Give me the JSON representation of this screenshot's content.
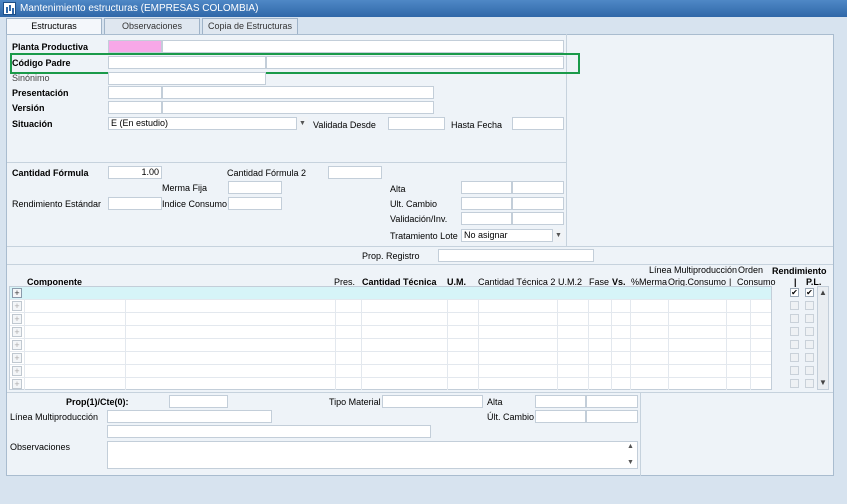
{
  "window": {
    "title": "Mantenimiento estructuras (EMPRESAS COLOMBIA)"
  },
  "tabs": [
    "Estructuras",
    "Observaciones",
    "Copia de Estructuras"
  ],
  "header": {
    "planta": "Planta Productiva",
    "codigo_padre": "Código Padre",
    "sinonimo": "Sinónimo",
    "presentacion": "Presentación",
    "version": "Versión",
    "situacion": "Situación",
    "situacion_value": "E (En estudio)",
    "validada_desde": "Validada Desde",
    "hasta_fecha": "Hasta Fecha"
  },
  "formula": {
    "cantidad_formula": "Cantidad Fórmula",
    "cantidad_formula_value": "1.00",
    "cantidad_formula_2": "Cantidad Fórmula 2",
    "merma_fija": "Merma Fija",
    "rendimiento_estandar": "Rendimiento  Estándar",
    "indice_consumo": "Indice Consumo",
    "alta": "Alta",
    "ult_cambio": "Ult. Cambio",
    "validacion": "Validación/Inv.",
    "tratamiento_lote": "Tratamiento Lote",
    "tratamiento_lote_value": "No asignar",
    "prop_registro": "Prop. Registro"
  },
  "grid": {
    "top_labels": {
      "linea": "Línea Multiproducción",
      "orden": "Orden",
      "rendimiento": "Rendimiento"
    },
    "cols": {
      "componente": "Componente",
      "pres": "Pres.",
      "cant_tecnica": "Cantidad Técnica",
      "um": "U.M.",
      "cant_tecnica_2": "Cantidad Técnica 2",
      "um2": "U.M.2",
      "fase": "Fase",
      "vs": "Vs.",
      "merma": "%Merma",
      "orig_consumo": "Orig.Consumo",
      "sep": "|",
      "consumo": "Consumo",
      "rend_bar": "|",
      "pl": "P.L."
    },
    "plus": "+",
    "check": "✔",
    "rows": 8
  },
  "footer": {
    "prop_cte": "Prop(1)/Cte(0):",
    "tipo_material": "Tipo Material",
    "alta": "Alta",
    "linea": "Línea Multiproducción",
    "ult_cambio": "Últ. Cambio",
    "observaciones": "Observaciones"
  },
  "icons": {
    "dropdown": "chevron-down-icon",
    "scroll_up": "scroll-up-icon",
    "scroll_down": "scroll-down-icon"
  },
  "colors": {
    "titlebar": "#2f67a8",
    "highlight": "#1a9a4a",
    "planta_input": "#f7a8e8",
    "selected_row": "#d6f4f8"
  }
}
